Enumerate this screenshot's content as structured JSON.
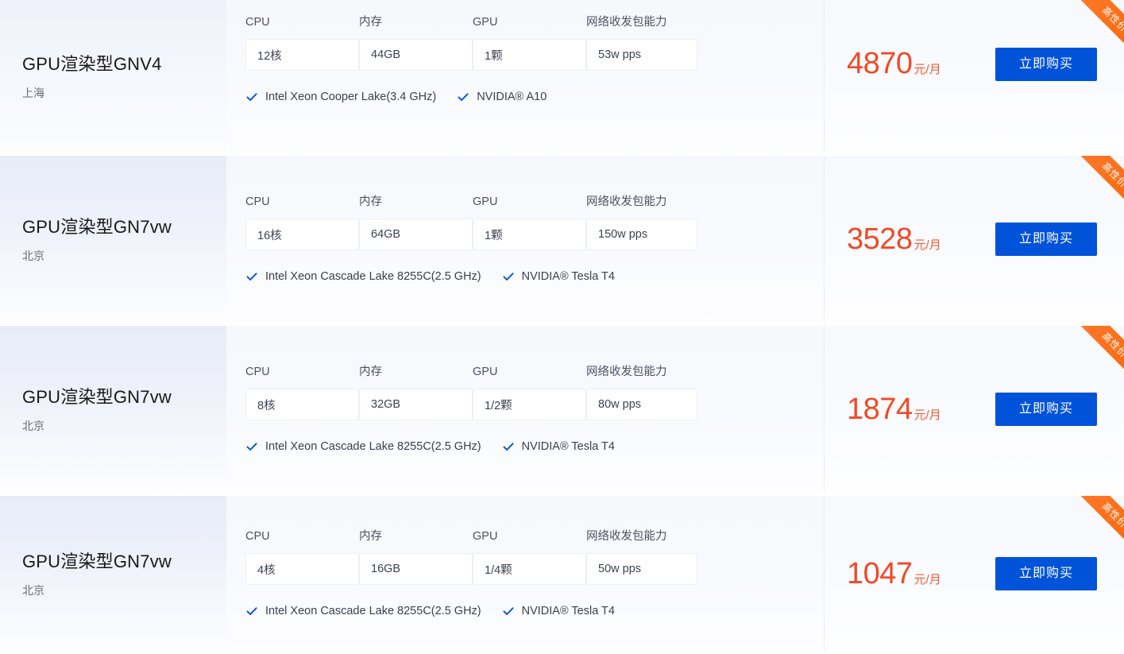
{
  "labels": {
    "cpu": "CPU",
    "memory": "内存",
    "gpu": "GPU",
    "network": "网络收发包能力"
  },
  "ribbon": {
    "text": "高性价比"
  },
  "buy_label": "立即购买",
  "price_unit": "元/月",
  "colors": {
    "accent_blue": "#0052d9",
    "price_orange": "#f04a26",
    "ribbon_orange": "#fa6400",
    "check_blue": "#0052d9"
  },
  "cards": [
    {
      "title": "GPU渲染型GNV4",
      "region": "上海",
      "cpu": "12核",
      "memory": "44GB",
      "gpu": "1颗",
      "network": "53w pps",
      "features": [
        "Intel Xeon Cooper Lake(3.4 GHz)",
        "NVIDIA® A10"
      ],
      "price": "4870",
      "badge": "高性价比",
      "buy_label": "立即购买"
    },
    {
      "title": "GPU渲染型GN7vw",
      "region": "北京",
      "cpu": "16核",
      "memory": "64GB",
      "gpu": "1颗",
      "network": "150w pps",
      "features": [
        "Intel Xeon Cascade Lake 8255C(2.5 GHz)",
        "NVIDIA® Tesla T4"
      ],
      "price": "3528",
      "badge": "高性价比",
      "buy_label": "立即购买"
    },
    {
      "title": "GPU渲染型GN7vw",
      "region": "北京",
      "cpu": "8核",
      "memory": "32GB",
      "gpu": "1/2颗",
      "network": "80w pps",
      "features": [
        "Intel Xeon Cascade Lake 8255C(2.5 GHz)",
        "NVIDIA® Tesla T4"
      ],
      "price": "1874",
      "badge": "高性价比",
      "buy_label": "立即购买"
    },
    {
      "title": "GPU渲染型GN7vw",
      "region": "北京",
      "cpu": "4核",
      "memory": "16GB",
      "gpu": "1/4颗",
      "network": "50w pps",
      "features": [
        "Intel Xeon Cascade Lake 8255C(2.5 GHz)",
        "NVIDIA® Tesla T4"
      ],
      "price": "1047",
      "badge": "高性价比",
      "buy_label": "立即购买"
    }
  ]
}
